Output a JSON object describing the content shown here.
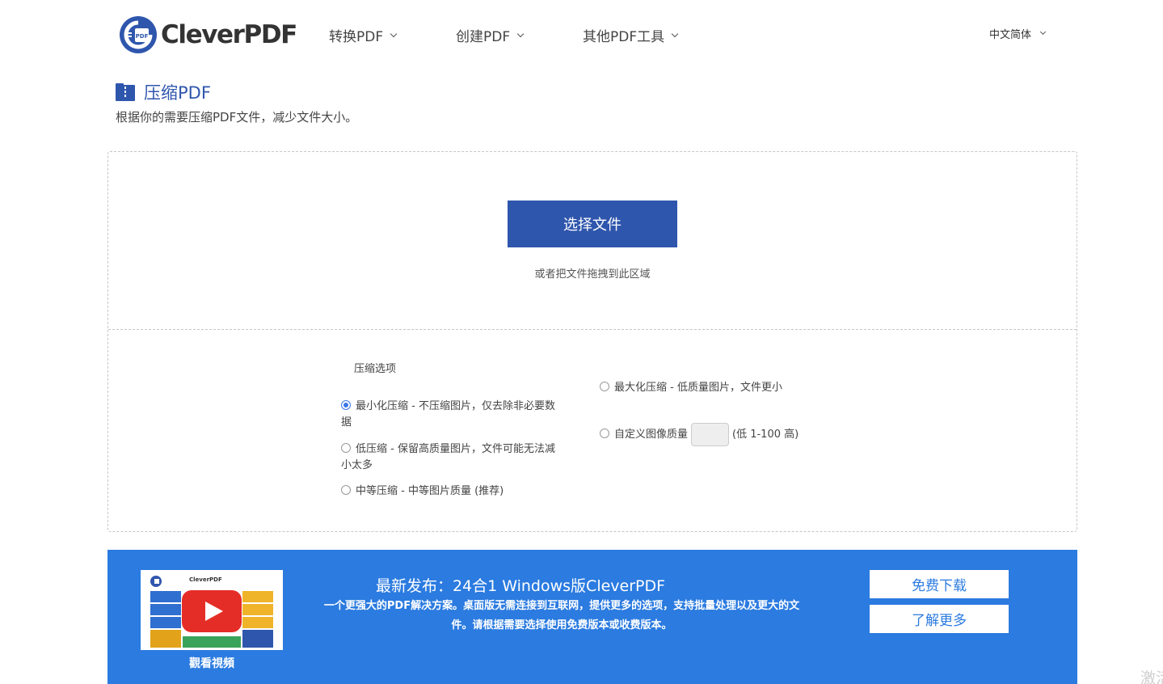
{
  "brand": {
    "logo_text": "CleverPDF",
    "logo_badge": "PDF",
    "primary_color": "#2f56ad",
    "banner_color": "#2b7be0"
  },
  "nav": {
    "items": [
      {
        "label": "转换PDF"
      },
      {
        "label": "创建PDF"
      },
      {
        "label": "其他PDF工具"
      }
    ],
    "language": "中文简体"
  },
  "page": {
    "icon": "zip-file-icon",
    "title": "压缩PDF",
    "subtitle": "根据你的需要压缩PDF文件，减少文件大小。"
  },
  "upload": {
    "select_label": "选择文件",
    "drop_hint": "或者把文件拖拽到此区域"
  },
  "compression": {
    "label": "压缩选项",
    "options": [
      {
        "label": "最小化压缩 - 不压缩图片，仅去除非必要数据",
        "checked": true
      },
      {
        "label": "低压缩 - 保留高质量图片，文件可能无法减小太多",
        "checked": false
      },
      {
        "label": "中等压缩 - 中等图片质量 (推荐)",
        "checked": false
      },
      {
        "label": "最大化压缩 - 低质量图片，文件更小",
        "checked": false
      },
      {
        "label": "自定义图像质量",
        "checked": false
      }
    ],
    "quality_hint": "(低 1-100 高)",
    "quality_value": ""
  },
  "banner": {
    "video_brand": "CleverPDF",
    "watch_label": "觀看視頻",
    "title": "最新发布：24合1 Windows版CleverPDF",
    "description": "一个更强大的PDF解决方案。桌面版无需连接到互联网，提供更多的选项，支持批量处理以及更大的文件。请根据需要选择使用免费版本或收费版本。",
    "download_label": "免费下载",
    "learn_more_label": "了解更多"
  },
  "corner_text": "激活"
}
